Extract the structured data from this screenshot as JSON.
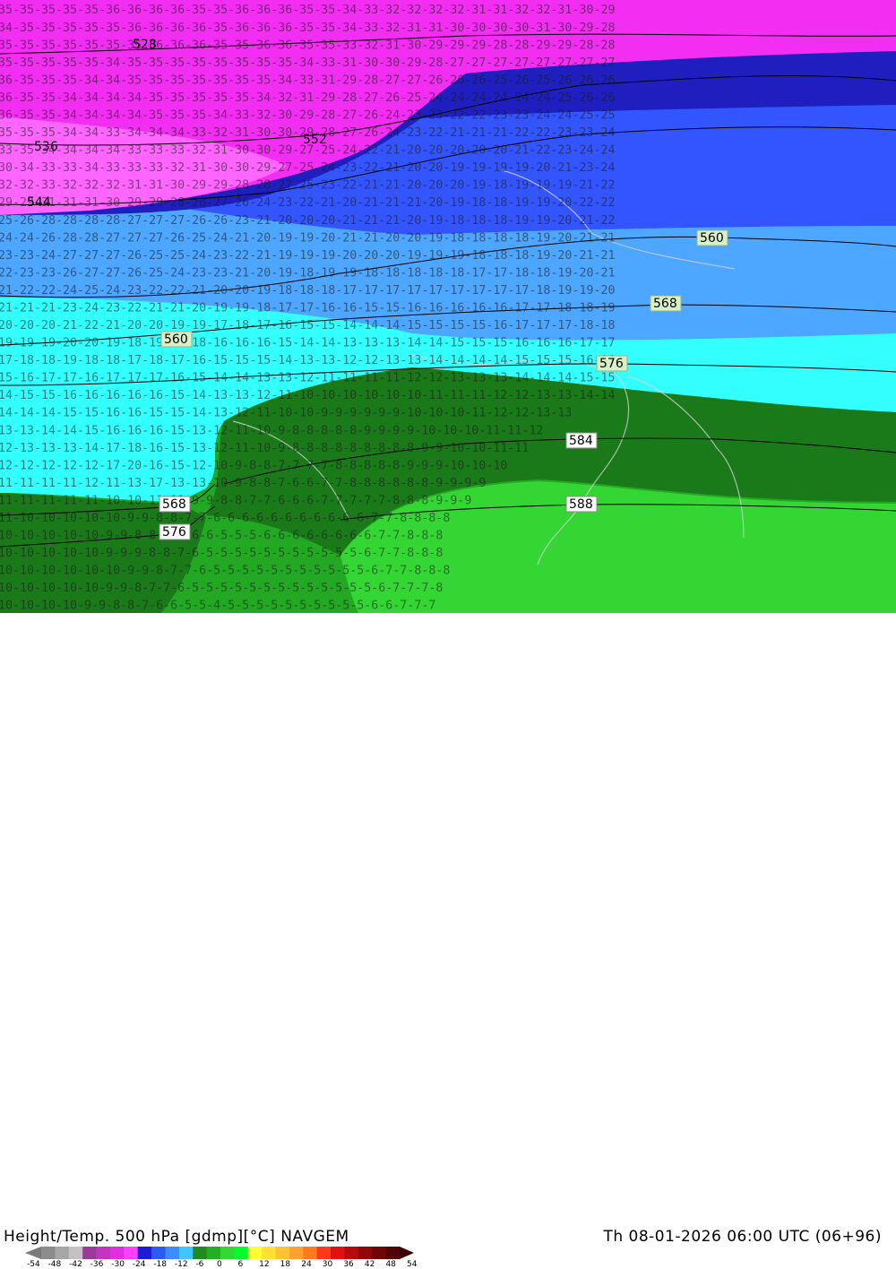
{
  "title": "Height/Temp. 500 hPa [gdmp][°C] NAVGEM",
  "datetime": "Th 08-01-2026 06:00 UTC (06+96)",
  "height_contour_labels": [
    "528",
    "536",
    "544",
    "552",
    "560",
    "560",
    "568",
    "568",
    "576",
    "576",
    "584",
    "588"
  ],
  "temperature_rows": [
    "35-35-35-35-35-36-36-36-36-35-35-36-36-36-35-35-34-33-32-32-32-32-31-31-32-32-31-30-29",
    "34-35-35-35-35-35-36-36-36-36-35-36-36-36-35-35-34-33-32-31-31-30-30-30-30-31-30-29-28",
    "35-35-35-35-35-35-35-36-36-36-35-35-36-36-35-35-33-32-31-30-29-29-29-28-28-29-29-28-28",
    "35-35-35-35-35-34-35-35-35-35-35-35-35-35-34-33-31-30-30-29-28-27-27-27-27-27-27-27-27",
    "36-35-35-35-34-34-35-35-35-35-35-35-35-34-33-31-29-28-27-27-26-26-26-25-26-25-26-26-26",
    "36-35-35-34-34-34-34-35-35-35-35-35-34-32-31-29-28-27-26-25-24-24-24-24-24-24-25-26-26",
    "36-35-35-34-34-34-34-35-35-35-34-33-32-30-29-28-27-26-24-23-23-22-22-23-23-24-24-25-25",
    "35-35-35-34-34-33-34-34-34-33-32-31-30-30-29-28-27-26-24-23-22-21-21-21-22-22-23-23-24",
    "33-35-34-34-34-34-33-33-33-32-31-30-30-29-27-25-24-22-21-20-20-20-20-20-21-22-23-24-24",
    "30-34-33-33-34-33-33-33-32-31-30-30-29-27-25-24-23-22-21-20-20-19-19-19-19-20-21-23-24",
    "32-32-33-32-32-32-31-31-30-29-29-28-28-27-25-23-22-21-21-20-20-20-19-18-19-19-19-21-22",
    "29-29-31-31-31-30-29-29-28-28-27-26-24-23-22-21-20-21-21-21-20-19-18-18-19-19-20-22-22",
    "25-26-28-28-28-28-27-27-27-26-26-23-21-20-20-20-21-21-21-20-19-18-18-18-19-19-20-21-22",
    "24-24-26-28-28-27-27-27-26-25-24-21-20-19-19-20-21-21-20-20-19-18-18-18-18-19-20-21-21",
    "23-23-24-27-27-27-26-25-25-24-23-22-21-19-19-19-20-20-20-19-19-19-18-18-18-19-20-21-21",
    "22-23-23-26-27-27-26-25-24-23-23-21-20-19-18-19-19-18-18-18-18-18-17-17-18-18-19-20-21",
    "21-22-22-24-25-24-23-22-22-21-20-20-19-18-18-18-17-17-17-17-17-17-17-17-17-18-19-19-20",
    "21-21-21-23-24-23-22-21-21-20-19-19-18-17-17-16-16-15-15-16-16-16-16-16-17-17-18-18-19",
    "20-20-20-21-22-21-20-20-19-19-17-18-17-16-15-15-14-14-14-15-15-15-15-16-17-17-17-18-18",
    "19-19-19-20-20-19-18-19-19-18-16-16-16-15-14-14-13-13-13-14-14-15-15-15-16-16-16-17-17",
    "17-18-18-19-18-18-17-18-17-16-15-15-15-14-13-13-12-12-13-13-14-14-14-14-15-15-15-16-16",
    "15-16-17-17-16-17-17-17-16-15-14-14-13-13-12-11-11-11-11-12-12-13-13-13-14-14-14-15-15",
    "14-15-15-16-16-16-16-16-15-14-13-13-12-11-10-10-10-10-10-10-11-11-11-12-12-13-13-14-14",
    "14-14-14-15-15-16-16-15-15-14-13-12-11-10-10-9-9-9-9-9-9-10-10-10-11-12-12-13-13",
    "13-13-14-14-15-16-16-16-15-13-12-11-10-9-8-8-8-8-8-9-9-9-9-10-10-10-11-11-12",
    "12-13-13-13-14-17-18-16-15-13-12-11-10-9-8-8-8-8-8-8-8-8-8-9-9-10-10-11-11",
    "12-12-12-12-12-17-20-16-15-12-10-9-8-8-7-7-7-7-8-8-8-8-8-9-9-9-10-10-10",
    "11-11-11-11-12-11-13-17-13-13-10-9-8-8-7-6-6-7-7-8-8-8-8-8-8-9-9-9-9",
    "11-11-11-11-11-10-10-11-11-9-9-8-8-7-7-6-6-6-7-7-7-7-7-8-8-8-9-9-9",
    "11-10-10-10-10-10-9-9-8-8-7-7-6-6-6-6-6-6-6-6-6-6-6-7-7-8-8-8-8",
    "10-10-10-10-10-9-9-8-8-8-7-6-6-5-5-5-6-6-6-6-6-6-6-6-7-7-8-8-8",
    "10-10-10-10-10-9-9-9-8-8-7-6-5-5-5-5-5-5-5-5-5-5-5-6-7-7-8-8-8",
    "10-10-10-10-10-10-9-9-8-7-7-6-5-5-5-5-5-5-5-5-5-5-5-6-7-7-8-8-8",
    "10-10-10-10-10-9-9-8-7-7-6-5-5-5-5-5-5-5-5-5-5-5-5-5-6-7-7-7-8",
    "10-10-10-10-9-9-8-8-7-6-6-5-5-4-5-5-5-5-5-5-5-5-5-5-6-6-7-7-7"
  ],
  "colorbar": {
    "ticks": [
      "-54",
      "-48",
      "-42",
      "-36",
      "-30",
      "-24",
      "-18",
      "-12",
      "-6",
      "0",
      "6",
      "12",
      "18",
      "24",
      "30",
      "36",
      "42",
      "48",
      "54"
    ],
    "colors": [
      "#8c8c8c",
      "#a6a6a6",
      "#c2c2c2",
      "#9a3b9a",
      "#c234c2",
      "#e22ee2",
      "#ff40ff",
      "#1c1cd6",
      "#2b5bf0",
      "#3c8cff",
      "#40c6ff",
      "#1e8c1e",
      "#22b022",
      "#33d933",
      "#00ff2a",
      "#ffff33",
      "#ffe033",
      "#ffc233",
      "#ffa033",
      "#ff7a20",
      "#ff3a1a",
      "#e21010",
      "#b80a0a",
      "#920808",
      "#6e0606",
      "#500404"
    ]
  },
  "field_colors": {
    "magenta": "#f22ef2",
    "pink": "#ff66ff",
    "navy": "#1f1fbf",
    "blue": "#3355ff",
    "light_blue": "#4da6ff",
    "cyan": "#33ffff",
    "dark_green": "#1a7a1a",
    "green": "#22a822",
    "bright_green": "#33d633"
  }
}
